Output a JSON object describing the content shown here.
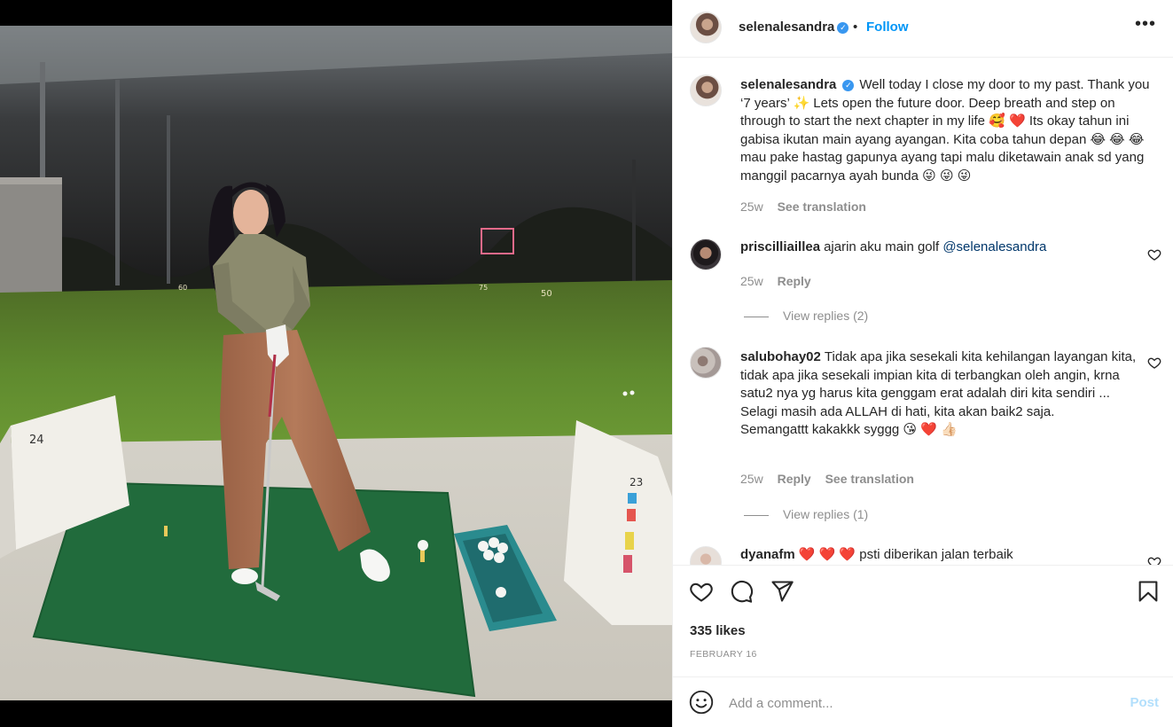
{
  "post": {
    "image_alt": "Woman standing on a golf driving range mat at night",
    "bay_numbers": [
      "24",
      "23"
    ],
    "range_markers": [
      "60",
      "75",
      "50"
    ]
  },
  "header": {
    "username": "selenalesandra",
    "verified": true,
    "separator": "•",
    "follow_label": "Follow",
    "more_label": "•••"
  },
  "caption": {
    "username": "selenalesandra",
    "text": "Well today I close my door to my past. Thank you ‘7 years’ ✨ Lets open the future door. Deep breath and step on through to start the next chapter in my life 🥰 ❤️ Its okay tahun ini gabisa ikutan main ayang ayangan. Kita coba tahun depan 😂 😂 😂 mau pake hastag gapunya ayang tapi malu diketawain anak sd yang manggil pacarnya ayah bunda 😜 😜 😜",
    "time": "25w",
    "see_translation": "See translation"
  },
  "comments": [
    {
      "username": "priscilliaillea",
      "text": "ajarin aku main golf ",
      "mention": "@selenalesandra",
      "time": "25w",
      "reply": "Reply",
      "view_replies": "View replies (2)"
    },
    {
      "username": "salubohay02",
      "text": "Tidak apa jika sesekali kita kehilangan layangan kita, tidak apa jika sesekali impian kita di terbangkan oleh angin, krna satu2 nya yg harus kita genggam erat adalah diri kita sendiri ...",
      "text2": "Selagi masih ada ALLAH di hati, kita akan baik2 saja.",
      "text3": "Semangattt kakakkk syggg 😘 ❤️ 👍🏻",
      "time": "25w",
      "reply": "Reply",
      "see_translation": "See translation",
      "view_replies": "View replies (1)"
    },
    {
      "username": "dyanafm",
      "text": "❤️ ❤️ ❤️ psti diberikan jalan terbaik"
    }
  ],
  "actions": {
    "likes": "335 likes",
    "date": "FEBRUARY 16"
  },
  "add_comment": {
    "placeholder": "Add a comment...",
    "post_label": "Post"
  },
  "colors": {
    "link_blue": "#0095f6",
    "post_disabled": "#b2dffc",
    "text": "#262626",
    "muted": "#8e8e8e"
  }
}
